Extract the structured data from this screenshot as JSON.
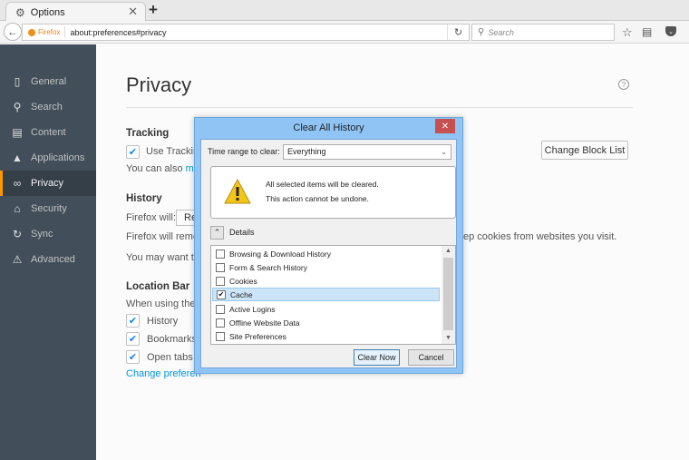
{
  "browser": {
    "tab": {
      "title": "Options",
      "icon": "gear-icon"
    },
    "new_tab": "+",
    "identity_label": "Firefox",
    "url": "about:preferences#privacy",
    "search_placeholder": "Search"
  },
  "sidebar": {
    "items": [
      {
        "label": "General",
        "icon": "general-icon",
        "glyph": "▯",
        "active": false
      },
      {
        "label": "Search",
        "icon": "search-icon",
        "glyph": "⚲",
        "active": false
      },
      {
        "label": "Content",
        "icon": "content-icon",
        "glyph": "▤",
        "active": false
      },
      {
        "label": "Applications",
        "icon": "applications-icon",
        "glyph": "▲",
        "active": false
      },
      {
        "label": "Privacy",
        "icon": "mask-icon",
        "glyph": "∞",
        "active": true
      },
      {
        "label": "Security",
        "icon": "security-icon",
        "glyph": "⌂",
        "active": false
      },
      {
        "label": "Sync",
        "icon": "sync-icon",
        "glyph": "↻",
        "active": false
      },
      {
        "label": "Advanced",
        "icon": "advanced-icon",
        "glyph": "⚠",
        "active": false
      }
    ]
  },
  "main": {
    "title": "Privacy",
    "help": "?",
    "tracking": {
      "heading": "Tracking",
      "checkbox_label": "Use Tracking",
      "checked": true,
      "also_text": "You can also ",
      "also_link": "ma",
      "block_list_button": "Change Block List"
    },
    "history": {
      "heading": "History",
      "will_label": "Firefox will:",
      "will_value": "Re",
      "remember_text": "Firefox will reme",
      "cookies_tail": "ep cookies from websites you visit.",
      "may_want": "You may want to"
    },
    "location_bar": {
      "heading": "Location Bar",
      "when_using": "When using the l",
      "options": [
        {
          "label": "History",
          "checked": true
        },
        {
          "label": "Bookmarks",
          "checked": true
        },
        {
          "label": "Open tabs",
          "checked": true
        }
      ],
      "change_link": "Change preferen"
    }
  },
  "dialog": {
    "title": "Clear All History",
    "close": "✕",
    "time_range_label": "Time range to clear:",
    "time_range_value": "Everything",
    "warning_line1": "All selected items will be cleared.",
    "warning_line2": "This action cannot be undone.",
    "details_label": "Details",
    "items": [
      {
        "label": "Browsing & Download History",
        "checked": false
      },
      {
        "label": "Form & Search History",
        "checked": false
      },
      {
        "label": "Cookies",
        "checked": false
      },
      {
        "label": "Cache",
        "checked": true
      },
      {
        "label": "Active Logins",
        "checked": false
      },
      {
        "label": "Offline Website Data",
        "checked": false
      },
      {
        "label": "Site Preferences",
        "checked": false
      }
    ],
    "clear_now": "Clear Now",
    "cancel": "Cancel"
  }
}
